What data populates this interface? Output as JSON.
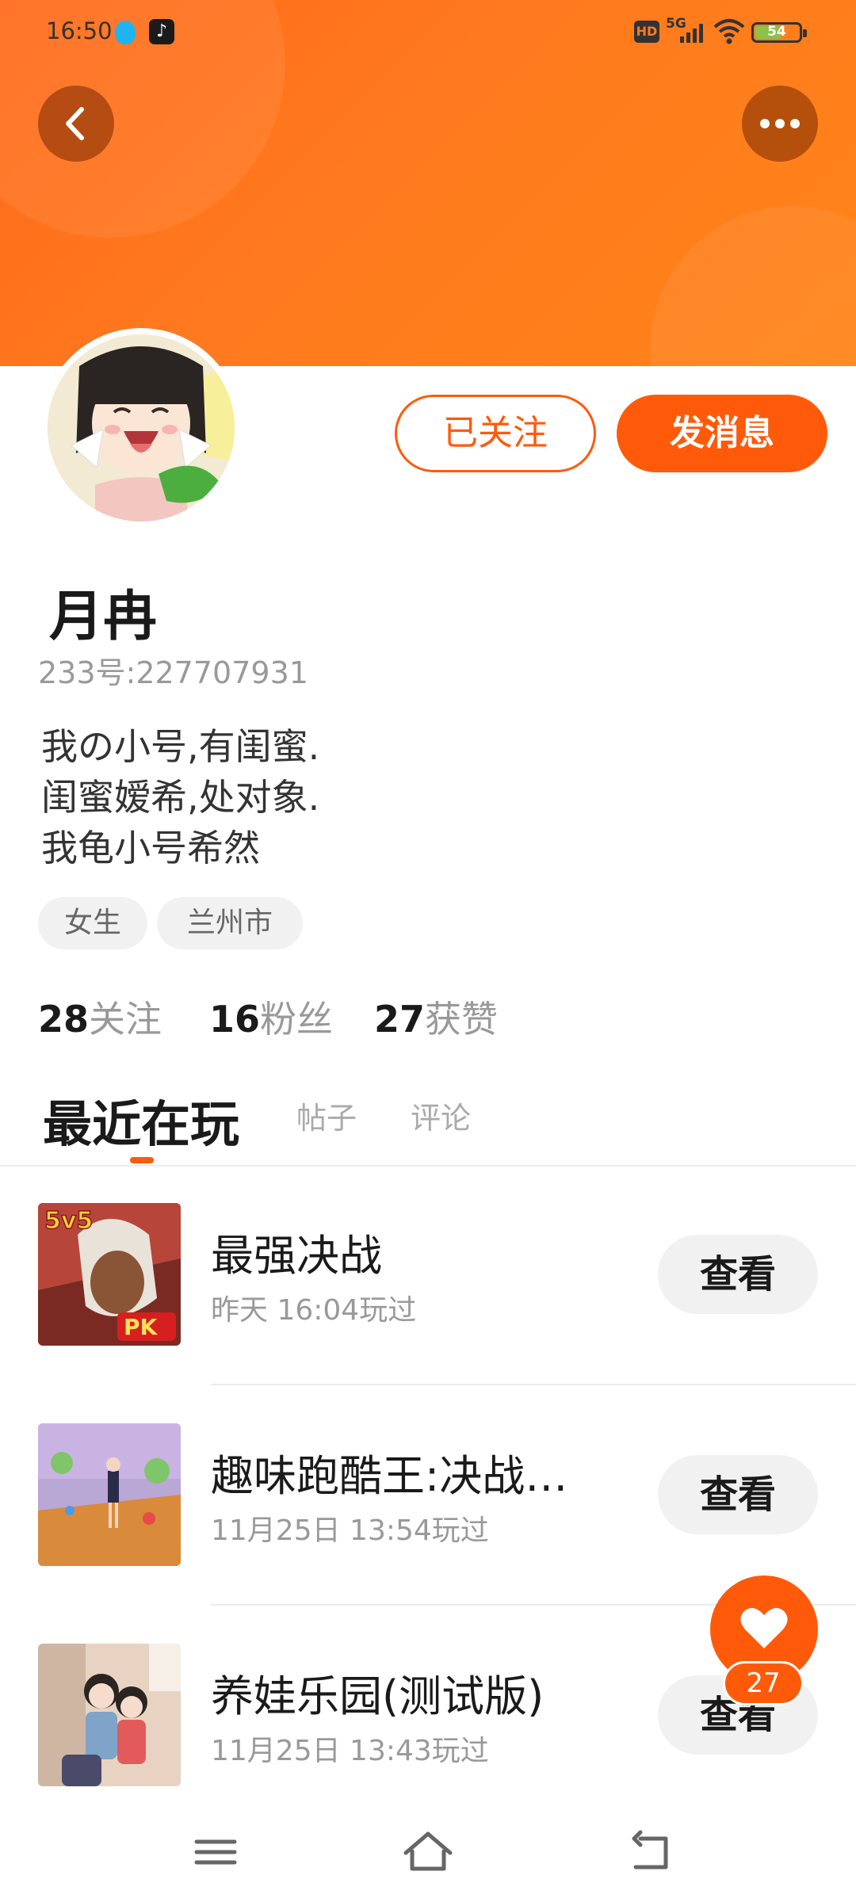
{
  "status_bar": {
    "time": "16:50",
    "tiktok_icon": "tiktok-icon",
    "hd_label": "HD",
    "network": "5G",
    "battery": "54"
  },
  "colors": {
    "accent": "#ff5a0a",
    "header_gradient_start": "#ff6a1a",
    "header_gradient_end": "#ff8419"
  },
  "profile": {
    "follow_label": "已关注",
    "message_label": "发消息",
    "username": "月冉",
    "user_id": "233号:227707931",
    "bio": [
      "我の小号,有闺蜜.",
      "闺蜜嫒希,处对象.",
      "我龟小号希然"
    ],
    "tags": [
      "女生",
      "兰州市"
    ]
  },
  "stats": {
    "following_count": "28",
    "following_label": "关注",
    "fans_count": "16",
    "fans_label": "粉丝",
    "likes_count": "27",
    "likes_label": "获赞"
  },
  "tabs": [
    {
      "label": "最近在玩",
      "active": true
    },
    {
      "label": "帖子",
      "active": false
    },
    {
      "label": "评论",
      "active": false
    }
  ],
  "games": [
    {
      "title": "最强决战",
      "time": "昨天 16:04玩过",
      "button": "查看"
    },
    {
      "title": "趣味跑酷王:决战…",
      "time": "11月25日 13:54玩过",
      "button": "查看"
    },
    {
      "title": "养娃乐园(测试版)",
      "time": "11月25日 13:43玩过",
      "button": "查看"
    }
  ],
  "fab": {
    "icon": "heart-icon",
    "count": "27"
  },
  "nav": {
    "menu_icon": "menu-icon",
    "home_icon": "home-icon",
    "back_icon": "back-icon"
  }
}
